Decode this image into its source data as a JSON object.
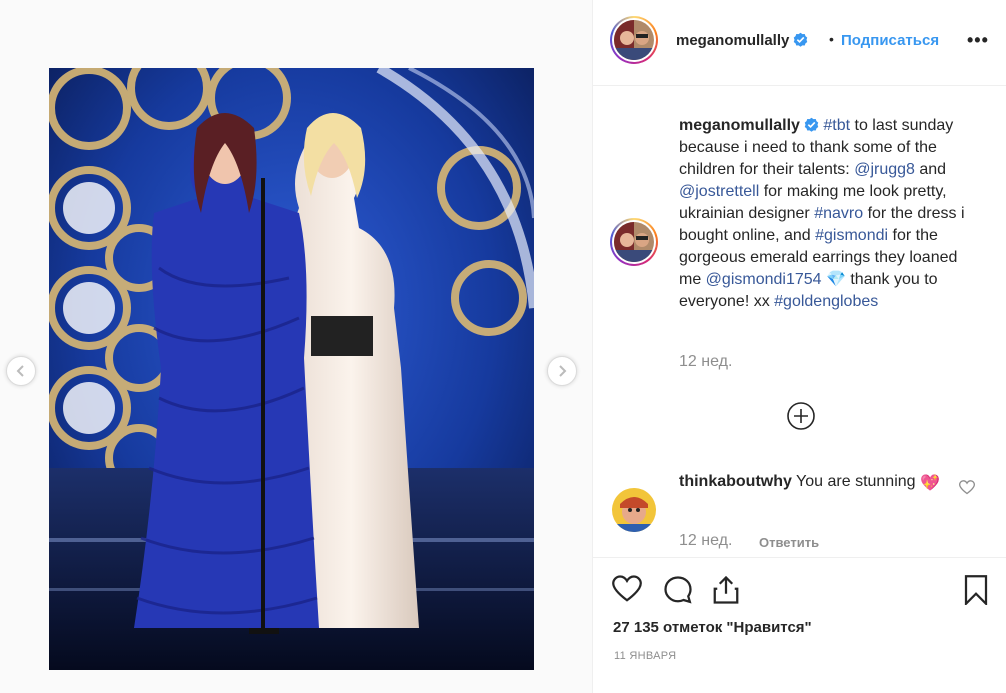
{
  "header": {
    "username": "meganomullally",
    "separator": "•",
    "follow_label": "Подписаться",
    "more_label": "•••"
  },
  "caption": {
    "username": "meganomullally",
    "parts": [
      {
        "type": "tag",
        "text": "#tbt"
      },
      {
        "type": "text",
        "text": " to last sunday because i need to thank some of the children for their talents: "
      },
      {
        "type": "tag",
        "text": "@jrugg8"
      },
      {
        "type": "text",
        "text": " and "
      },
      {
        "type": "tag",
        "text": "@jostrettell"
      },
      {
        "type": "text",
        "text": " for making me look pretty, ukrainian designer "
      },
      {
        "type": "tag",
        "text": "#navro"
      },
      {
        "type": "text",
        "text": " for the dress i bought online, and "
      },
      {
        "type": "tag",
        "text": "#gismondi"
      },
      {
        "type": "text",
        "text": " for the gorgeous emerald earrings they loaned me "
      },
      {
        "type": "tag",
        "text": "@gismondi1754"
      },
      {
        "type": "text",
        "text": " 💎 thank you to everyone! xx "
      },
      {
        "type": "tag",
        "text": "#goldenglobes"
      }
    ],
    "time": "12 нед."
  },
  "comment": {
    "username": "thinkaboutwhy",
    "text": "You are stunning",
    "emoji": "💖",
    "time": "12 нед.",
    "reply_label": "Ответить"
  },
  "actions": {
    "likes": "27 135 отметок \"Нравится\"",
    "date": "11 ЯНВАРЯ",
    "icons": [
      "heart-icon",
      "comment-icon",
      "share-icon",
      "bookmark-icon"
    ]
  },
  "colors": {
    "link": "#385898",
    "follow": "#3897f0",
    "muted": "#8e8e8e",
    "verified": "#3897f0"
  }
}
